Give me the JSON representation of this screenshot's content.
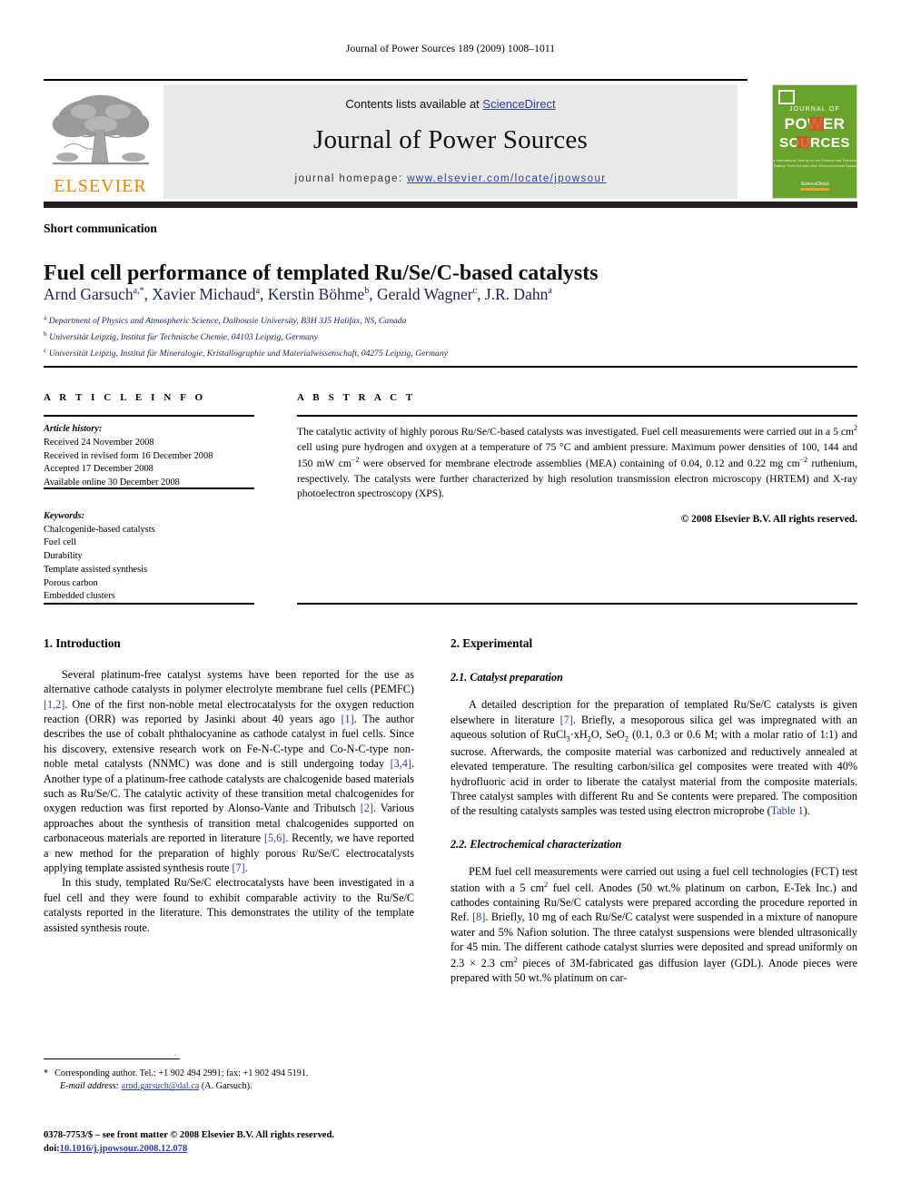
{
  "running_head": "Journal of Power Sources 189 (2009) 1008–1011",
  "masthead": {
    "contents_prefix": "Contents lists available at ",
    "sciencedirect": "ScienceDirect",
    "journal_name": "Journal of Power Sources",
    "homepage_label": "journal homepage:",
    "homepage_url": "www.elsevier.com/locate/jpowsour",
    "publisher_wordmark": "ELSEVIER",
    "cover": {
      "line1": "JOURNAL OF",
      "line2": "POWER",
      "line3": "SOURCES",
      "tagline": "The International Journal on the Science and Technology of Battery, Fuel Cell and other Electrochemical Systems",
      "footer": "ScienceDirect"
    },
    "accent_orange": "#F08000",
    "link_blue": "#2b3ea8",
    "cover_green": "#6aa32b"
  },
  "article": {
    "doc_type": "Short communication",
    "title": "Fuel cell performance of templated Ru/Se/C-based catalysts",
    "authors_html": "Arnd Garsuch<sup>a,*</sup>, Xavier Michaud<sup>a</sup>, Kerstin Böhme<sup>b</sup>, Gerald Wagner<sup>c</sup>, J.R. Dahn<sup>a</sup>",
    "affiliations": [
      "Department of Physics and Atmospheric Science, Dalhousie University, B3H 3J5 Halifax, NS, Canada",
      "Universität Leipzig, Institut für Technische Chemie, 04103 Leipzig, Germany",
      "Universität Leipzig, Institut für Mineralogie, Kristallographie und Materialwissenschaft, 04275 Leipzig, Germany"
    ],
    "affiliation_marks": [
      "a",
      "b",
      "c"
    ]
  },
  "info": {
    "heading": "A R T I C L E   I N F O",
    "history_label": "Article history:",
    "history": [
      "Received 24 November 2008",
      "Received in revised form 16 December 2008",
      "Accepted 17 December 2008",
      "Available online 30 December 2008"
    ],
    "keywords_label": "Keywords:",
    "keywords": [
      "Chalcogenide-based catalysts",
      "Fuel cell",
      "Durability",
      "Template assisted synthesis",
      "Porous carbon",
      "Embedded clusters"
    ]
  },
  "abstract": {
    "heading": "A B S T R A C T",
    "body_html": "The catalytic activity of highly porous Ru/Se/C-based catalysts was investigated. Fuel cell measurements were carried out in a 5 cm<sup>2</sup> cell using pure hydrogen and oxygen at a temperature of 75 °C and ambient pressure. Maximum power densities of 100, 144 and 150 mW cm<sup>−2</sup> were observed for membrane electrode assemblies (MEA) containing of 0.04, 0.12 and 0.22 mg cm<sup>−2</sup> ruthenium, respectively. The catalysts were further characterized by high resolution transmission electron microscopy (HRTEM) and X-ray photoelectron spectroscopy (XPS).",
    "copyright": "© 2008 Elsevier B.V. All rights reserved."
  },
  "sections": {
    "introduction": {
      "heading": "1.  Introduction",
      "paragraphs_html": [
        "Several platinum-free catalyst systems have been reported for the use as alternative cathode catalysts in polymer electrolyte membrane fuel cells (PEMFC) <span class=\"ref\">[1,2]</span>. One of the first non-noble metal electrocatalysts for the oxygen reduction reaction (ORR) was reported by Jasinki about 40 years ago <span class=\"ref\">[1]</span>. The author describes the use of cobalt phthalocyanine as cathode catalyst in fuel cells. Since his discovery, extensive research work on Fe-N-C-type and Co-N-C-type non-noble metal catalysts (NNMC) was done and is still undergoing today <span class=\"ref\">[3,4]</span>. Another type of a platinum-free cathode catalysts are chalcogenide based materials such as Ru/Se/C. The catalytic activity of these transition metal chalcogenides for oxygen reduction was first reported by Alonso-Vante and Tributsch <span class=\"ref\">[2]</span>. Various approaches about the synthesis of transition metal chalcogenides supported on carbonaceous materials are reported in literature <span class=\"ref\">[5,6]</span>. Recently, we have reported a new method for the preparation of highly porous Ru/Se/C electrocatalysts applying template assisted synthesis route <span class=\"ref\">[7]</span>.",
        "In this study, templated Ru/Se/C electrocatalysts have been investigated in a fuel cell and they were found to exhibit comparable activity to the Ru/Se/C catalysts reported in the literature. This demonstrates the utility of the template assisted synthesis route."
      ]
    },
    "experimental": {
      "heading": "2.  Experimental",
      "sub1_heading": "2.1.  Catalyst preparation",
      "sub1_paragraph_html": "A detailed description for the preparation of templated Ru/Se/C catalysts is given elsewhere in literature <span class=\"ref\">[7]</span>. Briefly, a mesoporous silica gel was impregnated with an aqueous solution of RuCl<sub>3</sub>·xH<sub>2</sub>O, SeO<sub>2</sub> (0.1, 0.3 or 0.6 M; with a molar ratio of 1:1) and sucrose. Afterwards, the composite material was carbonized and reductively annealed at elevated temperature. The resulting carbon/silica gel composites were treated with 40% hydrofluoric acid in order to liberate the catalyst material from the composite materials. Three catalyst samples with different Ru and Se contents were prepared. The composition of the resulting catalysts samples was tested using electron microprobe (<span class=\"ref\">Table 1</span>).",
      "sub2_heading": "2.2.  Electrochemical characterization",
      "sub2_paragraph_html": "PEM fuel cell measurements were carried out using a fuel cell technologies (FCT) test station with a 5 cm<sup>2</sup> fuel cell. Anodes (50 wt.% platinum on carbon, E-Tek Inc.) and cathodes containing Ru/Se/C catalysts were prepared according the procedure reported in Ref. <span class=\"ref\">[8]</span>. Briefly, 10 mg of each Ru/Se/C catalyst were suspended in a mixture of nanopure water and 5% Nafion solution. The three catalyst suspensions were blended ultrasonically for 45 min. The different cathode catalyst slurries were deposited and spread uniformly on 2.3 × 2.3 cm<sup>2</sup> pieces of 3M-fabricated gas diffusion layer (GDL). Anode pieces were prepared with 50 wt.% platinum on car-"
    }
  },
  "footnotes": {
    "star": "*",
    "corresponding_html": "Corresponding author. Tel.: +1 902 494 2991; fax: +1 902 494 5191.",
    "email_label": "E-mail address:",
    "email": "arnd.garsuch@dal.ca",
    "email_suffix": "(A. Garsuch).",
    "issn_html": "0378-7753/$ – see front matter © 2008 Elsevier B.V. All rights reserved.",
    "doi_label": "doi:",
    "doi": "10.1016/j.jpowsour.2008.12.078"
  }
}
